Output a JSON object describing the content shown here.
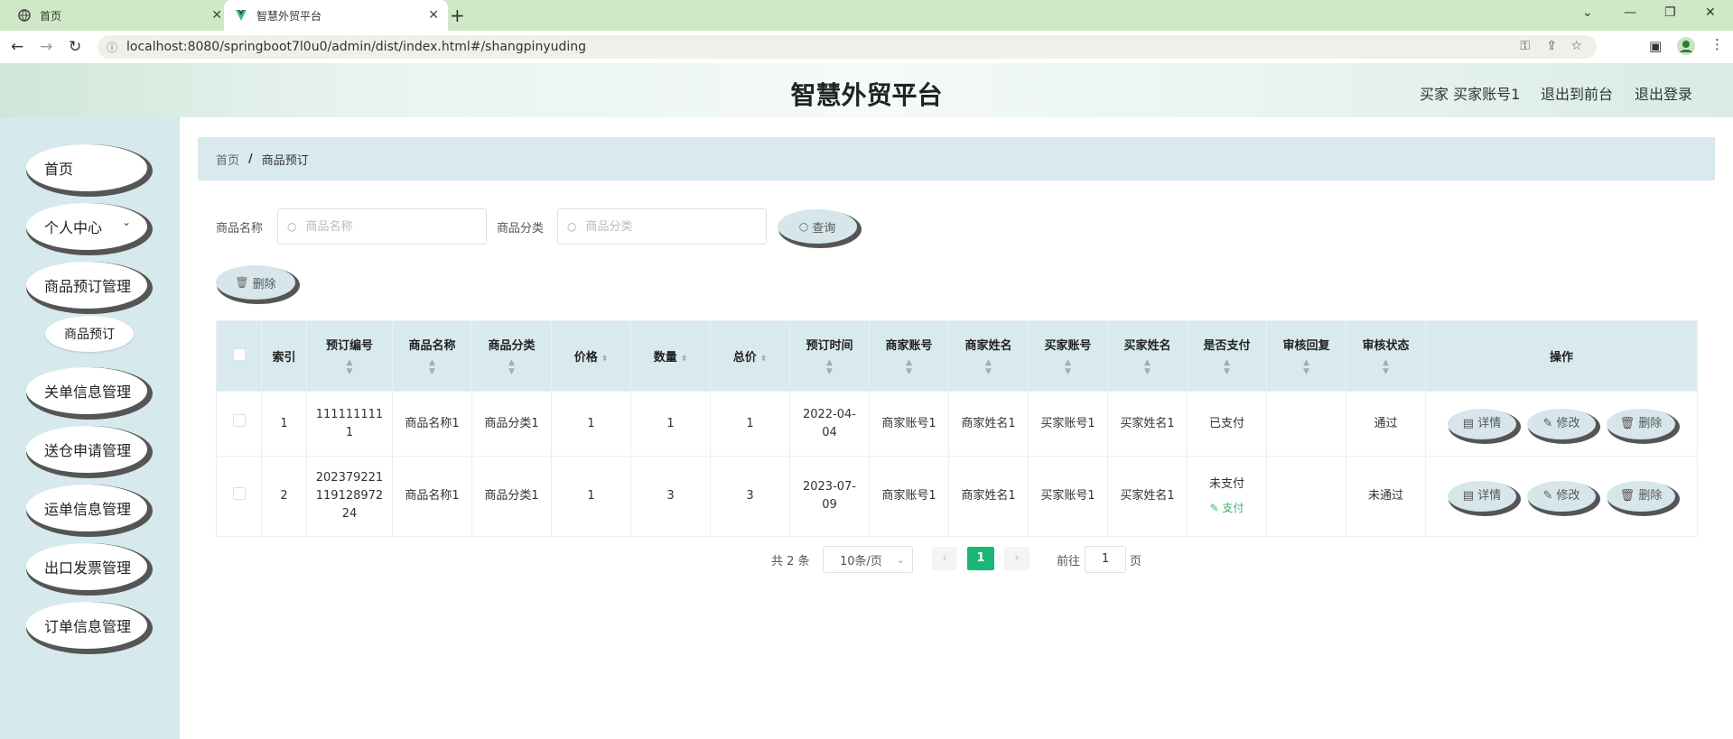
{
  "browser": {
    "tabs": [
      {
        "label": "首页"
      },
      {
        "label": "智慧外贸平台"
      }
    ],
    "url": "localhost:8080/springboot7l0u0/admin/dist/index.html#/shangpinyuding"
  },
  "header": {
    "title": "智慧外贸平台",
    "user": "买家 买家账号1",
    "to_front": "退出到前台",
    "logout": "退出登录"
  },
  "sidebar": {
    "items": [
      {
        "label": "首页"
      },
      {
        "label": "个人中心"
      },
      {
        "label": "商品预订管理"
      },
      {
        "label": "商品预订"
      },
      {
        "label": "关单信息管理"
      },
      {
        "label": "送仓申请管理"
      },
      {
        "label": "运单信息管理"
      },
      {
        "label": "出口发票管理"
      },
      {
        "label": "订单信息管理"
      }
    ]
  },
  "breadcrumb": {
    "home": "首页",
    "separator": "/",
    "current": "商品预订"
  },
  "search": {
    "name_label": "商品名称",
    "name_placeholder": "商品名称",
    "category_label": "商品分类",
    "category_placeholder": "商品分类",
    "query_button": "查询",
    "delete_button": "删除"
  },
  "table": {
    "headers": [
      "索引",
      "预订编号",
      "商品名称",
      "商品分类",
      "价格",
      "数量",
      "总价",
      "预订时间",
      "商家账号",
      "商家姓名",
      "买家账号",
      "买家姓名",
      "是否支付",
      "审核回复",
      "审核状态",
      "操作"
    ],
    "rows": [
      {
        "index": "1",
        "code": "1111111111",
        "name": "商品名称1",
        "category": "商品分类1",
        "price": "1",
        "qty": "1",
        "total": "1",
        "time": "2022-04-04",
        "seller_acct": "商家账号1",
        "seller_name": "商家姓名1",
        "buyer_acct": "买家账号1",
        "buyer_name": "买家姓名1",
        "paid": "已支付",
        "reply": "",
        "status": "通过"
      },
      {
        "index": "2",
        "code": "20237922111912897224",
        "name": "商品名称1",
        "category": "商品分类1",
        "price": "1",
        "qty": "3",
        "total": "3",
        "time": "2023-07-09",
        "seller_acct": "商家账号1",
        "seller_name": "商家姓名1",
        "buyer_acct": "买家账号1",
        "buyer_name": "买家姓名1",
        "paid": "未支付",
        "pay_link": "支付",
        "reply": "",
        "status": "未通过"
      }
    ],
    "actions": {
      "detail": "详情",
      "edit": "修改",
      "delete": "删除"
    }
  },
  "pagination": {
    "total": "共 2 条",
    "page_size": "10条/页",
    "current": "1",
    "goto_prefix": "前往",
    "goto_value": "1",
    "goto_suffix": "页"
  },
  "colors": {
    "accent": "#19b877",
    "sidebar_bg": "#d6e9ec",
    "header_row_bg": "#d9eaef"
  }
}
